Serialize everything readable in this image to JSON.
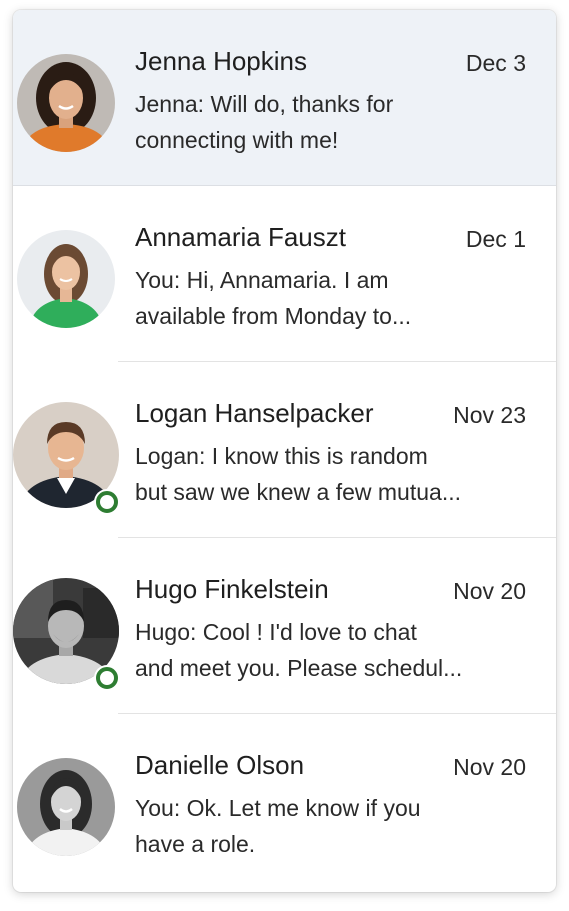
{
  "conversations": [
    {
      "name": "Jenna Hopkins",
      "date": "Dec 3",
      "preview_line1": "Jenna: Will do, thanks for",
      "preview_line2": "connecting with me!",
      "online": false,
      "selected": true,
      "avatar_bg": "#bfbab5",
      "avatar_color": "color"
    },
    {
      "name": "Annamaria Fauszt",
      "date": "Dec 1",
      "preview_line1": "You: Hi, Annamaria. I am",
      "preview_line2": "available from Monday to...",
      "online": false,
      "selected": false,
      "avatar_bg": "#e9ecef",
      "avatar_color": "color"
    },
    {
      "name": "Logan Hanselpacker",
      "date": "Nov 23",
      "preview_line1": "Logan: I know this is random",
      "preview_line2": "but saw we knew a few mutua...",
      "online": true,
      "selected": false,
      "avatar_bg": "#d8cfc6",
      "avatar_color": "color"
    },
    {
      "name": "Hugo Finkelstein",
      "date": "Nov 20",
      "preview_line1": "Hugo: Cool ! I'd love to chat",
      "preview_line2": "and meet you. Please schedul...",
      "online": true,
      "selected": false,
      "avatar_bg": "#3a3a3a",
      "avatar_color": "grayscale"
    },
    {
      "name": "Danielle Olson",
      "date": "Nov 20",
      "preview_line1": "You: Ok. Let me know if you",
      "preview_line2": "have a role.",
      "online": false,
      "selected": false,
      "avatar_bg": "#9a9a9a",
      "avatar_color": "grayscale"
    }
  ],
  "colors": {
    "selected_row": "#eef2f7",
    "presence_ring": "#2e7d32",
    "text_primary": "#1f1f1f"
  }
}
